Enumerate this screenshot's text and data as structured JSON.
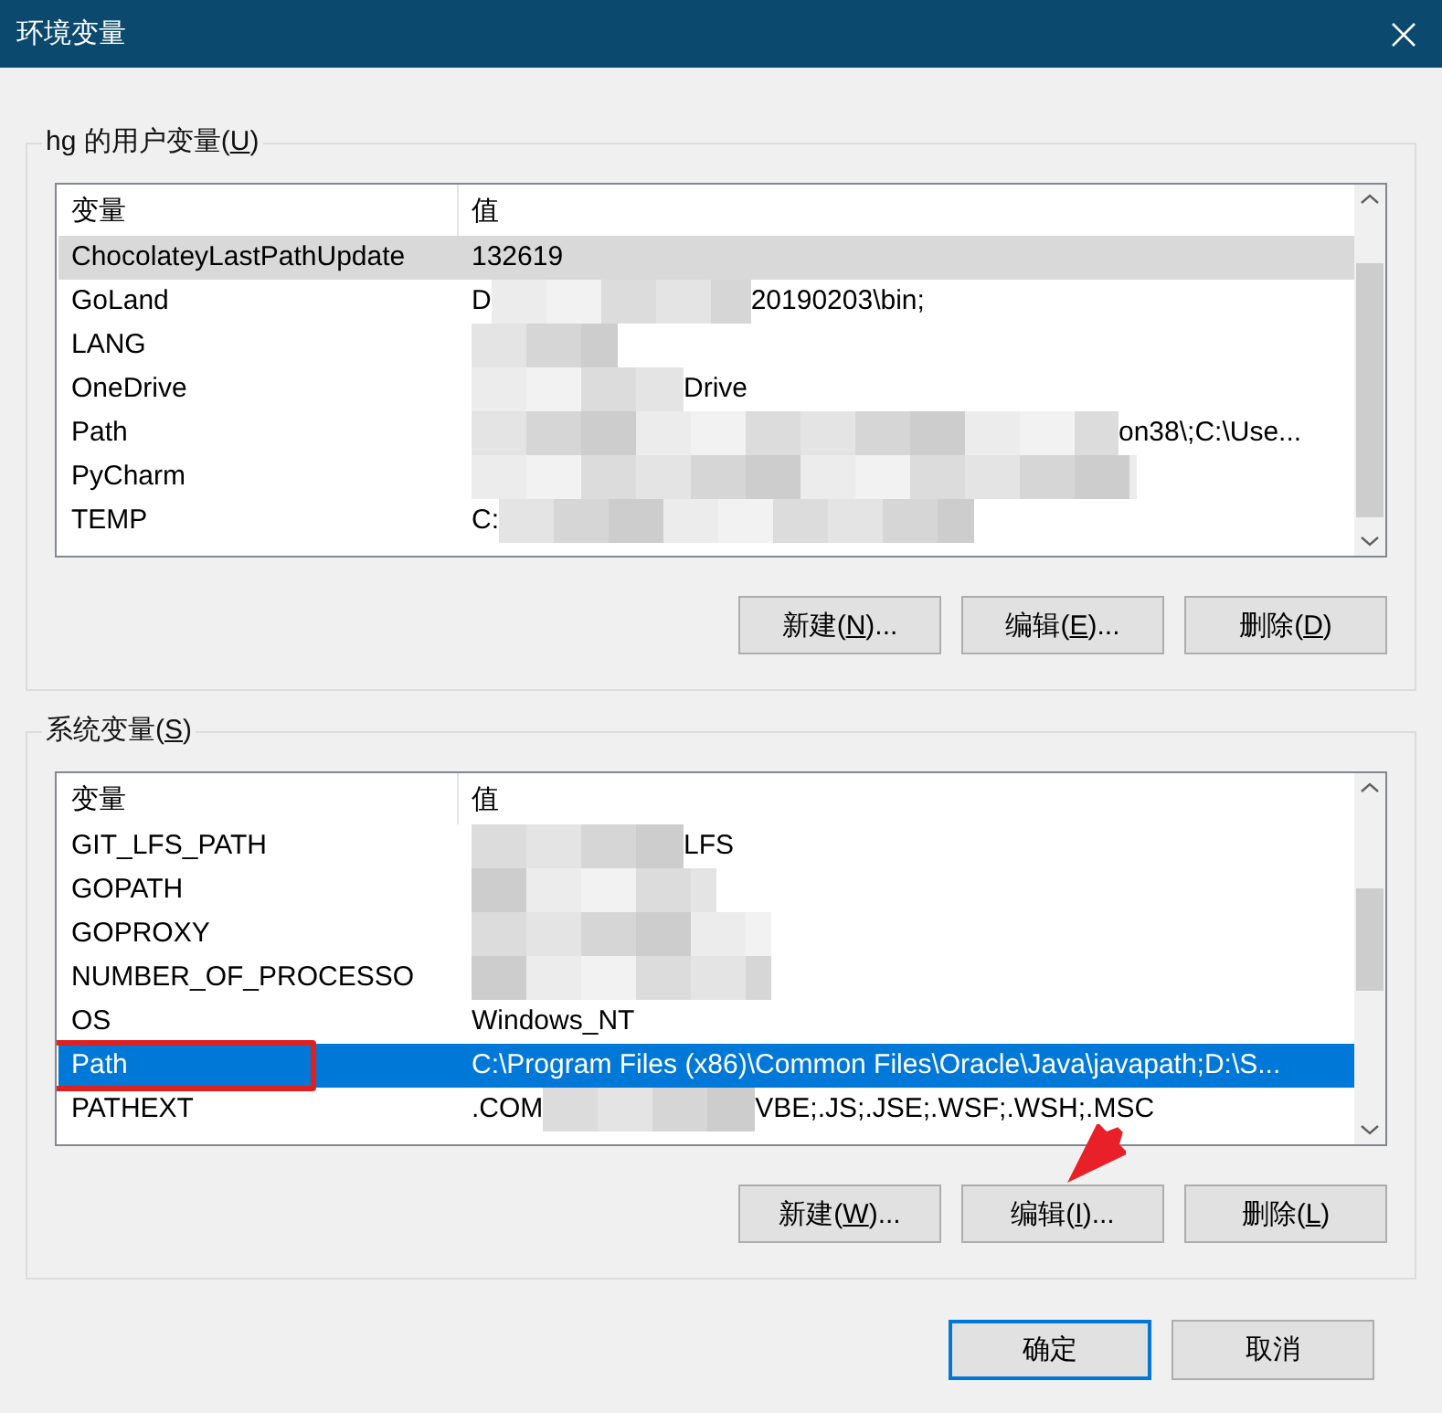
{
  "window": {
    "title": "环境变量"
  },
  "groups": [
    {
      "label_before": "hg 的用户变量(",
      "mnemonic": "U",
      "label_after": ")",
      "active": false,
      "columns": [
        "变量",
        "值"
      ],
      "rows": [
        {
          "name": "ChocolateyLastPathUpdate",
          "value_head": "1326",
          "value_tail": "19",
          "selected": true,
          "marked": false
        },
        {
          "name": "GoLand",
          "value_head": "D",
          "value_tail": "20190203\\bin;",
          "selected": false,
          "marked": false
        },
        {
          "name": "LANG",
          "selected": false,
          "marked": false
        },
        {
          "name": "OneDrive",
          "value_tail": "Drive",
          "selected": false,
          "marked": false
        },
        {
          "name": "Path",
          "value_tail": "on38\\;C:\\Use...",
          "selected": false,
          "marked": false
        },
        {
          "name": "PyCharm",
          "selected": false,
          "marked": false
        },
        {
          "name": "TEMP",
          "value_head": "C:",
          "selected": false,
          "marked": false
        }
      ],
      "buttons": [
        {
          "label_before": "新建(",
          "mnemonic": "N",
          "label_after": ")...",
          "pointed": false
        },
        {
          "label_before": "编辑(",
          "mnemonic": "E",
          "label_after": ")...",
          "pointed": false
        },
        {
          "label_before": "删除(",
          "mnemonic": "D",
          "label_after": ")",
          "pointed": false
        }
      ]
    },
    {
      "label_before": "系统变量(",
      "mnemonic": "S",
      "label_after": ")",
      "active": true,
      "columns": [
        "变量",
        "值"
      ],
      "rows": [
        {
          "name": "GIT_LFS_PATH",
          "value_tail": "LFS",
          "selected": false,
          "marked": false
        },
        {
          "name": "GOPATH",
          "selected": false,
          "marked": false
        },
        {
          "name": "GOPROXY",
          "selected": false,
          "marked": false
        },
        {
          "name": "NUMBER_OF_PROCESSO",
          "selected": false,
          "marked": false
        },
        {
          "name": "OS",
          "value_head": "Windows_NT",
          "selected": false,
          "marked": false
        },
        {
          "name": "Path",
          "value_head": "C:\\Program Files (x86)\\Common Files\\Oracle\\Java\\javapath;D:\\S...",
          "selected": true,
          "marked": true
        },
        {
          "name": "PATHEXT",
          "value_head": ".COM",
          "value_tail": "VBE;.JS;.JSE;.WSF;.WSH;.MSC",
          "selected": false,
          "marked": false
        }
      ],
      "buttons": [
        {
          "label_before": "新建(",
          "mnemonic": "W",
          "label_after": ")...",
          "pointed": false
        },
        {
          "label_before": "编辑(",
          "mnemonic": "I",
          "label_after": ")...",
          "pointed": true
        },
        {
          "label_before": "删除(",
          "mnemonic": "L",
          "label_after": ")",
          "pointed": false
        }
      ]
    }
  ],
  "footer_buttons": [
    {
      "label": "确定",
      "default": true
    },
    {
      "label": "取消",
      "default": false
    }
  ]
}
